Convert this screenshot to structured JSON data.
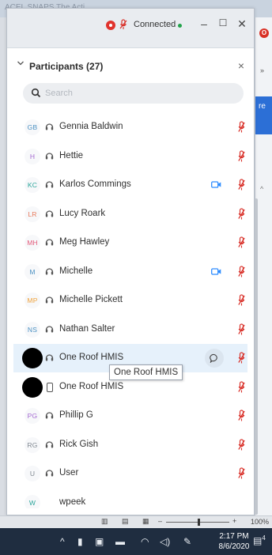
{
  "background": {
    "tab_strip_text": "ACEL  SNAPS  The Acti",
    "blue_tab_text": "re",
    "red_badge": "O",
    "chevrons": "»",
    "up_arrow": "^"
  },
  "window": {
    "connection_status": "Connected",
    "minimize_label": "–",
    "maximize_label": "☐",
    "close_label": "✕",
    "accent_color": "#2d8cff",
    "muted_color": "#d9322b",
    "status_dot_color": "#22a34a"
  },
  "participants_panel": {
    "title": "Participants (27)",
    "close_label": "×",
    "search_placeholder": "Search",
    "tooltip_text": "One Roof HMIS",
    "participants": [
      {
        "initials": "GB",
        "name": "Gennia Baldwin",
        "initials_color": "#4a90c2",
        "device": "headset",
        "video": false,
        "muted": true
      },
      {
        "initials": "H",
        "name": "Hettie",
        "initials_color": "#a56ad2",
        "device": "headset",
        "video": false,
        "muted": true
      },
      {
        "initials": "KC",
        "name": "Karlos Commings",
        "initials_color": "#2aa59a",
        "device": "headset",
        "video": true,
        "muted": true
      },
      {
        "initials": "LR",
        "name": "Lucy Roark",
        "initials_color": "#e8795a",
        "device": "headset",
        "video": false,
        "muted": true
      },
      {
        "initials": "MH",
        "name": "Meg Hawley",
        "initials_color": "#e35a7a",
        "device": "headset",
        "video": false,
        "muted": true
      },
      {
        "initials": "M",
        "name": "Michelle",
        "initials_color": "#4a90c2",
        "device": "headset",
        "video": true,
        "muted": true
      },
      {
        "initials": "MP",
        "name": "Michelle Pickett",
        "initials_color": "#f0a23b",
        "device": "headset",
        "video": false,
        "muted": true
      },
      {
        "initials": "NS",
        "name": "Nathan Salter",
        "initials_color": "#4a90c2",
        "device": "headset",
        "video": false,
        "muted": true
      },
      {
        "initials": "",
        "name": "One Roof HMIS",
        "initials_color": "#000000",
        "device": "headset",
        "video": false,
        "muted": true,
        "highlighted": true,
        "chat_bubble": true
      },
      {
        "initials": "",
        "name": "One Roof HMIS",
        "initials_color": "#000000",
        "device": "phone",
        "video": false,
        "muted": true
      },
      {
        "initials": "PG",
        "name": "Phillip G",
        "initials_color": "#a56ad2",
        "device": "headset",
        "video": false,
        "muted": true
      },
      {
        "initials": "RG",
        "name": "Rick Gish",
        "initials_color": "#7f8790",
        "device": "headset",
        "video": false,
        "muted": true
      },
      {
        "initials": "U",
        "name": "User",
        "initials_color": "#7f8790",
        "device": "headset",
        "video": false,
        "muted": true
      },
      {
        "initials": "W",
        "name": "wpeek",
        "initials_color": "#2aa59a",
        "device": "none",
        "video": false,
        "muted": false
      }
    ]
  },
  "statusbar": {
    "minus": "–",
    "plus": "+",
    "zoom_percent": "100%"
  },
  "taskbar": {
    "time": "2:17 PM",
    "date": "8/6/2020",
    "notification_count": "4"
  }
}
